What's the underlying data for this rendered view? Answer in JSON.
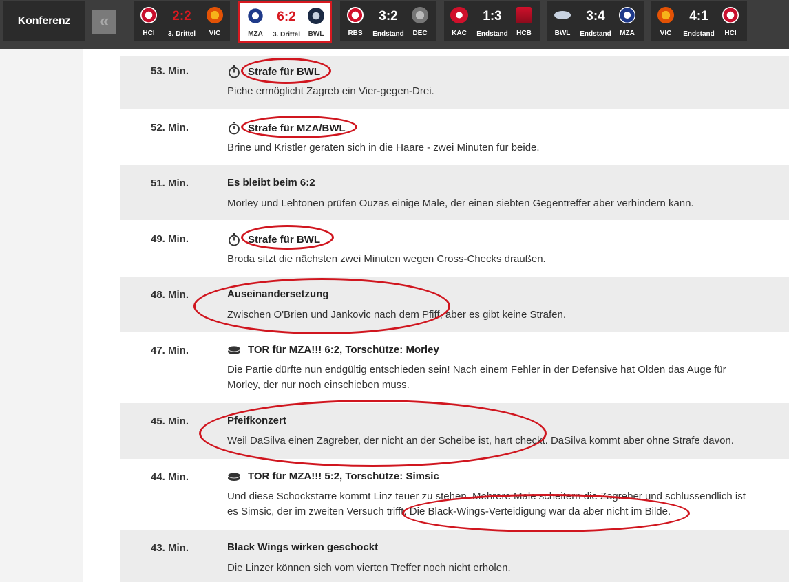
{
  "topbar": {
    "konferenz_label": "Konferenz",
    "prev_label": "«",
    "games": [
      {
        "home": "HCI",
        "away": "VIC",
        "score": "2:2",
        "status": "3. Drittel",
        "live": true,
        "active": false
      },
      {
        "home": "MZA",
        "away": "BWL",
        "score": "6:2",
        "status": "3. Drittel",
        "live": true,
        "active": true
      },
      {
        "home": "RBS",
        "away": "DEC",
        "score": "3:2",
        "status": "Endstand",
        "live": false,
        "active": false
      },
      {
        "home": "KAC",
        "away": "HCB",
        "score": "1:3",
        "status": "Endstand",
        "live": false,
        "active": false
      },
      {
        "home": "BWL",
        "away": "MZA",
        "score": "3:4",
        "status": "Endstand",
        "live": false,
        "active": false
      },
      {
        "home": "VIC",
        "away": "HCI",
        "score": "4:1",
        "status": "Endstand",
        "live": false,
        "active": false
      }
    ]
  },
  "feed": [
    {
      "minute": "53. Min.",
      "icon": "stopwatch-icon",
      "headline": "Strafe für BWL",
      "text": "Piche ermöglicht Zagreb ein Vier-gegen-Drei."
    },
    {
      "minute": "52. Min.",
      "icon": "stopwatch-icon",
      "headline": "Strafe für MZA/BWL",
      "text": "Brine und Kristler geraten sich in die Haare - zwei Minuten für beide."
    },
    {
      "minute": "51. Min.",
      "icon": "",
      "headline": "Es bleibt beim 6:2",
      "text": "Morley und Lehtonen prüfen Ouzas einige Male, der einen siebten Gegentreffer aber verhindern kann."
    },
    {
      "minute": "49. Min.",
      "icon": "stopwatch-icon",
      "headline": "Strafe für BWL",
      "text": "Broda sitzt die nächsten zwei Minuten wegen Cross-Checks draußen."
    },
    {
      "minute": "48. Min.",
      "icon": "",
      "headline": "Auseinandersetzung",
      "text": "Zwischen O'Brien und Jankovic nach dem Pfiff, aber es gibt keine Strafen."
    },
    {
      "minute": "47. Min.",
      "icon": "puck-icon",
      "headline": "TOR für MZA!!! 6:2, Torschütze: Morley",
      "text": "Die Partie dürfte nun endgültig entschieden sein! Nach einem Fehler in der Defensive hat Olden das Auge für Morley, der nur noch einschieben muss."
    },
    {
      "minute": "45. Min.",
      "icon": "",
      "headline": "Pfeifkonzert",
      "text": "Weil DaSilva einen Zagreber, der nicht an der Scheibe ist, hart checkt. DaSilva kommt aber ohne Strafe davon."
    },
    {
      "minute": "44. Min.",
      "icon": "puck-icon",
      "headline": "TOR für MZA!!! 5:2, Torschütze: Simsic",
      "text": "Und diese Schockstarre kommt Linz teuer zu stehen. Mehrere Male scheitern die Zagreber und schlussendlich ist es Simsic, der im zweiten Versuch trifft. Die Black-Wings-Verteidigung war da aber nicht im Bilde."
    },
    {
      "minute": "43. Min.",
      "icon": "",
      "headline": "Black Wings wirken geschockt",
      "text": "Die Linzer können sich vom vierten Treffer noch nicht erholen."
    }
  ],
  "colors": {
    "accent": "#d71920",
    "annotation": "#d0161f",
    "bar": "#3d3d3d",
    "tile": "#2b2b2b",
    "shaded_row": "#ececec"
  }
}
